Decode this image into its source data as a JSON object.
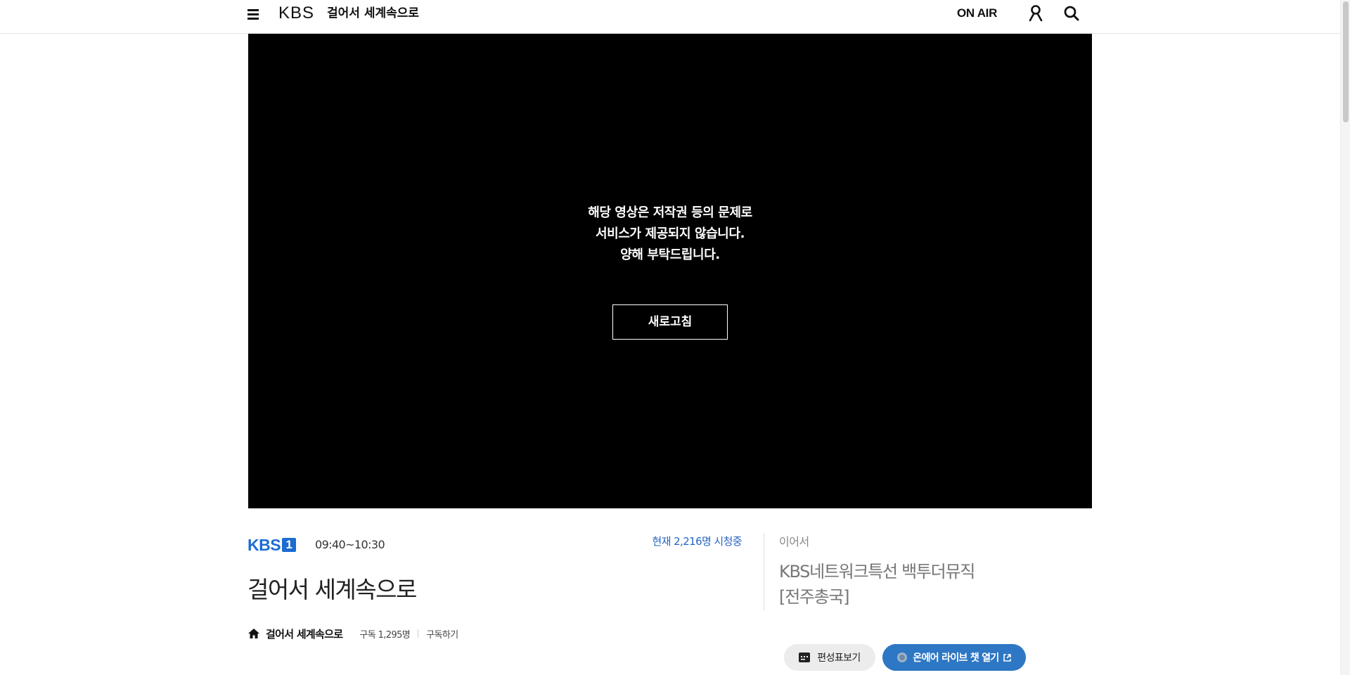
{
  "header": {
    "logo": "KBS",
    "program_title": "걸어서 세계속으로",
    "onair_label": "ON AIR"
  },
  "player": {
    "message_lines": [
      "해당 영상은 저작권 등의 문제로",
      "서비스가 제공되지 않습니다.",
      "양해 부탁드립니다."
    ],
    "refresh_label": "새로고침"
  },
  "info": {
    "channel_logo": "KBS",
    "channel_number": "1",
    "time": "09:40~10:30",
    "viewers": "현재 2,216명 시청중",
    "title": "걸어서 세계속으로",
    "home_link": "걸어서 세계속으로",
    "subscribers": "구독 1,295명",
    "subscribe_label": "구독하기"
  },
  "next": {
    "label": "이어서",
    "title_line1": "KBS네트워크특선 백투더뮤직",
    "title_line2": "[전주총국]"
  },
  "buttons": {
    "schedule_label": "편성표보기",
    "chat_label": "온에어 라이브 챗 열기"
  },
  "colors": {
    "accent_blue": "#2d77c4",
    "kbs1_blue": "#1c6cd1",
    "viewers_blue": "#2764c4"
  },
  "icons": {
    "menu": "hamburger-icon",
    "user": "user-icon",
    "search": "search-icon",
    "home": "home-icon",
    "schedule": "schedule-icon",
    "external": "external-link-icon"
  }
}
